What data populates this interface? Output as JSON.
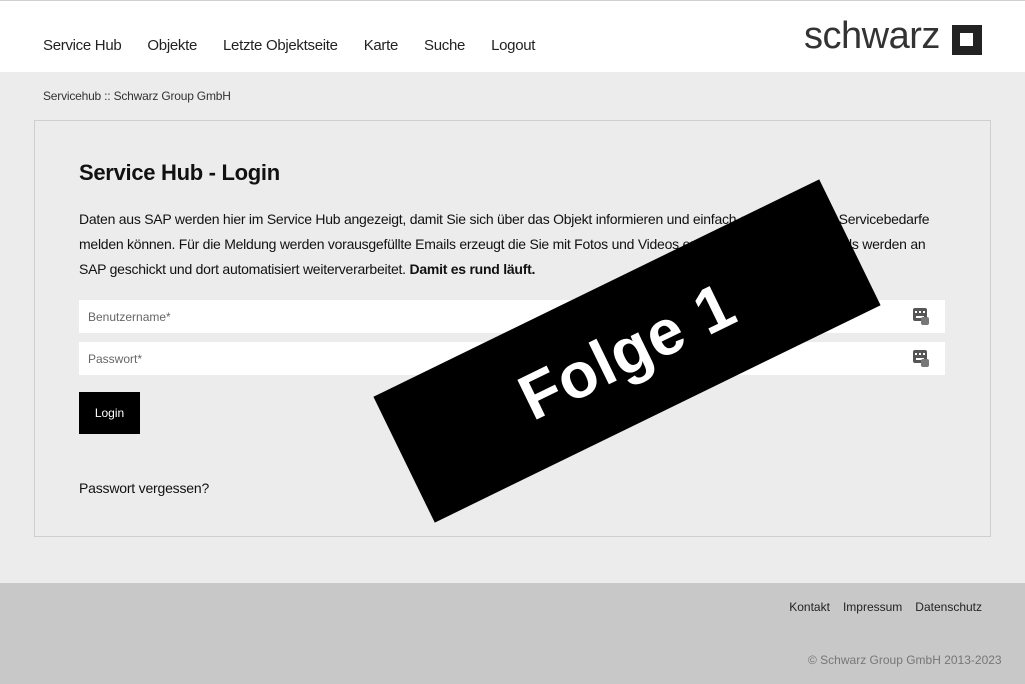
{
  "header": {
    "nav": [
      "Service Hub",
      "Objekte",
      "Letzte Objektseite",
      "Karte",
      "Suche",
      "Logout"
    ],
    "logo_text": "schwarz"
  },
  "breadcrumb": "Servicehub :: Schwarz Group GmbH",
  "login": {
    "title": "Service Hub - Login",
    "description": "Daten aus SAP werden hier im Service Hub angezeigt, damit Sie sich über das Objekt informieren und einfach aussagekräftige Servicebedarfe melden können. Für die Meldung werden vorausgefüllte Emails erzeugt die Sie mit Fotos und Videos ergänzen können. Die Emails werden an SAP geschickt und dort automatisiert weiterverarbeitet.",
    "description_bold": "Damit es rund läuft.",
    "username_placeholder": "Benutzername*",
    "password_placeholder": "Passwort*",
    "login_button": "Login",
    "forgot_link": "Passwort vergessen?"
  },
  "stamp_text": "Folge 1",
  "footer": {
    "links": [
      "Kontakt",
      "Impressum",
      "Datenschutz"
    ],
    "copyright": "© Schwarz Group GmbH 2013-2023"
  },
  "colors": {
    "accent": "#000000",
    "page_bg": "#ececec",
    "footer_bg": "#c8c8c8"
  },
  "icons": {
    "field_icon": "keyboard-key-icon"
  }
}
